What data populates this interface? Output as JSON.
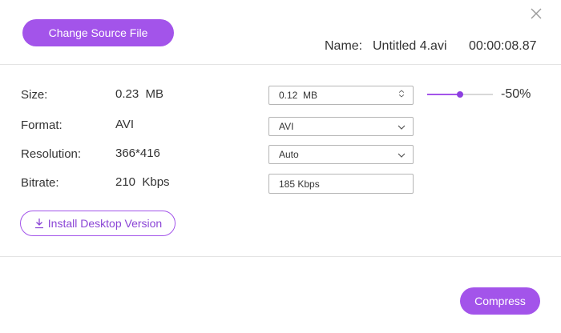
{
  "header": {
    "change_source_label": "Change Source File",
    "name_label": "Name:",
    "file_name": "Untitled 4.avi",
    "duration": "00:00:08.87"
  },
  "rows": {
    "size": {
      "label": "Size:",
      "value": "0.23  MB"
    },
    "format": {
      "label": "Format:",
      "value": "AVI"
    },
    "resolution": {
      "label": "Resolution:",
      "value": "366*416"
    },
    "bitrate": {
      "label": "Bitrate:",
      "value": "210  Kbps"
    }
  },
  "controls": {
    "size_input": "0.12  MB",
    "format_select": "AVI",
    "resolution_select": "Auto",
    "bitrate_input": "185 Kbps",
    "slider_fraction": 0.5,
    "slider_label": "-50%"
  },
  "install_label": "Install Desktop Version",
  "compress_label": "Compress",
  "colors": {
    "accent": "#a354ea",
    "divider": "#e4e4e4"
  },
  "icons": [
    "close-icon",
    "chevron-down-icon",
    "stepper-icon",
    "download-icon"
  ]
}
